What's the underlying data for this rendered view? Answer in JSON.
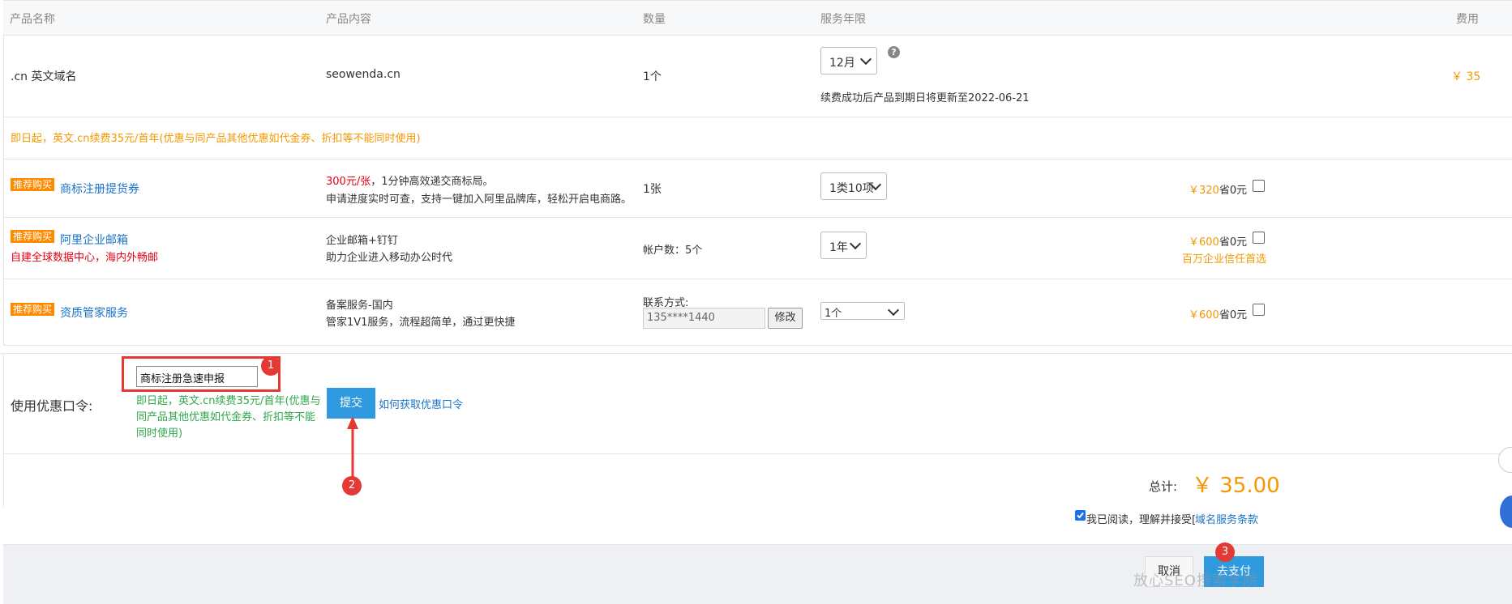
{
  "header": {
    "col_name": "产品名称",
    "col_content": "产品内容",
    "col_qty": "数量",
    "col_term": "服务年限",
    "col_fee": "费用"
  },
  "domain_row": {
    "name": ".cn 英文域名",
    "content": "seowenda.cn",
    "qty": "1个",
    "term_value": "12月",
    "expiry_note": "续费成功后产品到期日将更新至2022-06-21",
    "fee": "￥ 35"
  },
  "promo_notice": "即日起，英文.cn续费35元/首年(优惠与同产品其他优惠如代金券、折扣等不能同时使用)",
  "addons": [
    {
      "tag": "推荐购买",
      "name": "商标注册提货券",
      "content_highlight": "300元/张",
      "content_line1_rest": "，1分钟高效递交商标局。",
      "content_line2": "申请进度实时可查，支持一键加入阿里品牌库，轻松开启电商路。",
      "qty": "1张",
      "term_value": "1类10项",
      "price": "￥320",
      "save": "省0元"
    },
    {
      "tag": "推荐购买",
      "name": "阿里企业邮箱",
      "subtitle": "自建全球数据中心，海内外畅邮",
      "content_line1": "企业邮箱+钉钉",
      "content_line2": "助力企业进入移动办公时代",
      "qty": "帐户数：5个",
      "term_value": "1年",
      "price": "￥600",
      "save": "省0元",
      "note": "百万企业信任首选"
    },
    {
      "tag": "推荐购买",
      "name": "资质管家服务",
      "content_line1": "备案服务-国内",
      "content_line2": "管家1V1服务，流程超简单，通过更快捷",
      "contact_label": "联系方式:",
      "contact_value": "135****1440",
      "edit_label": "修改",
      "term_value": "1个",
      "price": "￥600",
      "save": "省0元"
    }
  ],
  "coupon": {
    "label": "使用优惠口令:",
    "input_value": "商标注册急速申报",
    "green_note_1": "即日起，英文.cn续费35元/首年(优惠与",
    "green_note_2": "同产品其他优惠如代金券、折扣等不能",
    "green_note_3": "同时使用)",
    "submit_label": "提交",
    "how_link": "如何获取优惠口令"
  },
  "summary": {
    "total_label": "总计:",
    "total_value": "￥ 35.00",
    "agree_text": "我已阅读，理解并接受[",
    "terms_link": "域名服务条款"
  },
  "footer": {
    "cancel_label": "取消",
    "pay_label": "去支付",
    "watermark": "放心SEO搜索学院"
  },
  "annotations": {
    "badge1": "1",
    "badge2": "2",
    "badge3": "3",
    "highlight_color": "#e53935"
  }
}
